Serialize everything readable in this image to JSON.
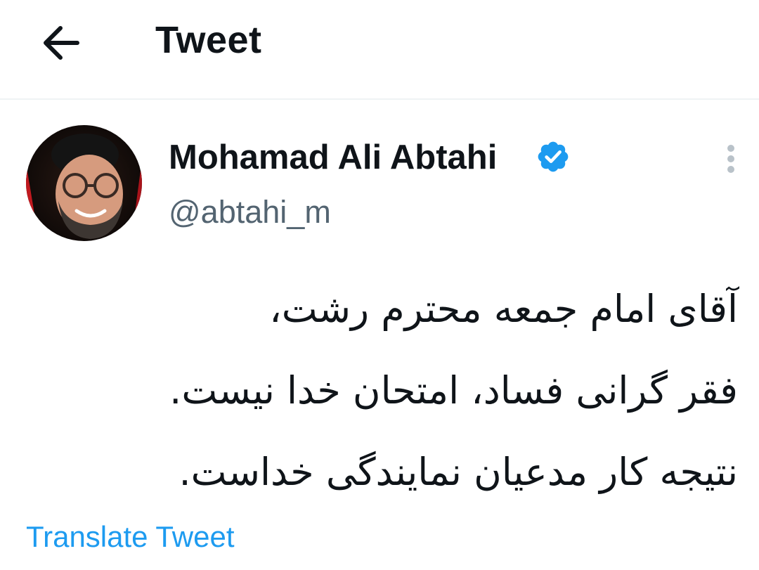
{
  "header": {
    "title": "Tweet",
    "back_icon": "arrow-left-icon"
  },
  "tweet": {
    "author": {
      "display_name": "Mohamad Ali Abtahi",
      "handle": "@abtahi_m",
      "verified": true,
      "verified_icon": "verified-badge-icon",
      "verified_color": "#1d9bf0"
    },
    "more_icon": "more-vertical-icon",
    "text_lines": [
      "آقای امام جمعه محترم رشت،",
      "فقر گرانی فساد، امتحان خدا نیست.",
      "نتیجه کار مدعیان نمایندگی خداست."
    ],
    "translate_label": "Translate Tweet"
  },
  "colors": {
    "text_primary": "#0f1419",
    "text_secondary": "#536471",
    "accent": "#1d9bf0",
    "divider": "#eff3f4"
  }
}
